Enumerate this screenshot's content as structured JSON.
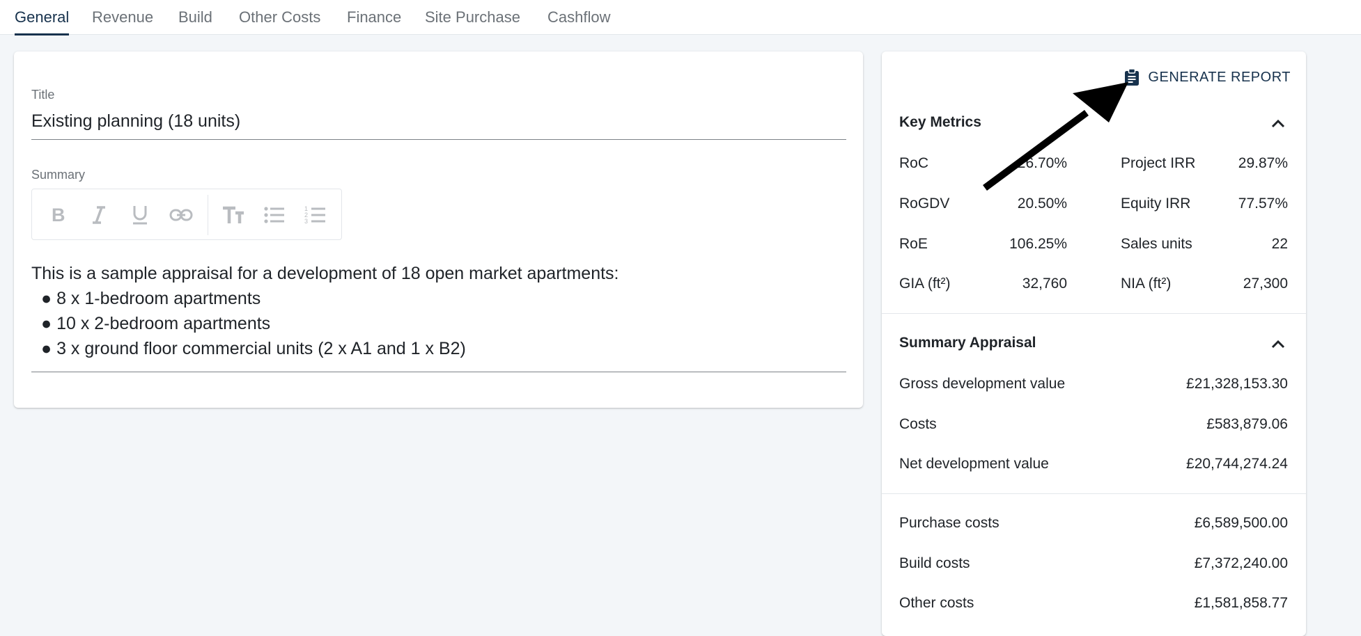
{
  "tabs": [
    "General",
    "Revenue",
    "Build",
    "Other Costs",
    "Finance",
    "Site Purchase",
    "Cashflow"
  ],
  "active_tab": "General",
  "general": {
    "title_label": "Title",
    "title_value": "Existing planning (18 units)",
    "summary_label": "Summary",
    "summary_intro": "This is a sample appraisal for a development of 18 open market apartments:",
    "summary_bullets": [
      "8 x 1-bedroom apartments",
      "10 x 2-bedroom apartments",
      "3 x ground floor commercial units (2 x A1 and 1 x B2)"
    ],
    "bullet_char": "●"
  },
  "editor_toolbar": {
    "icons": [
      "bold-icon",
      "italic-icon",
      "underline-icon",
      "link-icon",
      "text-size-icon",
      "bulleted-list-icon",
      "numbered-list-icon"
    ]
  },
  "report": {
    "generate_label": "GENERATE REPORT",
    "icon": "clipboard-icon"
  },
  "key_metrics": {
    "title": "Key Metrics",
    "rows": [
      {
        "label1": "RoC",
        "value1": "26.70%",
        "label2": "Project IRR",
        "value2": "29.87%"
      },
      {
        "label1": "RoGDV",
        "value1": "20.50%",
        "label2": "Equity IRR",
        "value2": "77.57%"
      },
      {
        "label1": "RoE",
        "value1": "106.25%",
        "label2": "Sales units",
        "value2": "22"
      },
      {
        "label1": "GIA (ft²)",
        "value1": "32,760",
        "label2": "NIA (ft²)",
        "value2": "27,300"
      }
    ]
  },
  "summary_appraisal": {
    "title": "Summary Appraisal",
    "rows": [
      {
        "label": "Gross development value",
        "value": "£21,328,153.30"
      },
      {
        "label": "Costs",
        "value": "£583,879.06"
      },
      {
        "label": "Net development value",
        "value": "£20,744,274.24"
      }
    ],
    "cost_rows": [
      {
        "label": "Purchase costs",
        "value": "£6,589,500.00"
      },
      {
        "label": "Build costs",
        "value": "£7,372,240.00"
      },
      {
        "label": "Other costs",
        "value": "£1,581,858.77"
      }
    ]
  },
  "colors": {
    "accent": "#17324d",
    "background": "#f3f6f9",
    "annotation_arrow": "#000000"
  }
}
